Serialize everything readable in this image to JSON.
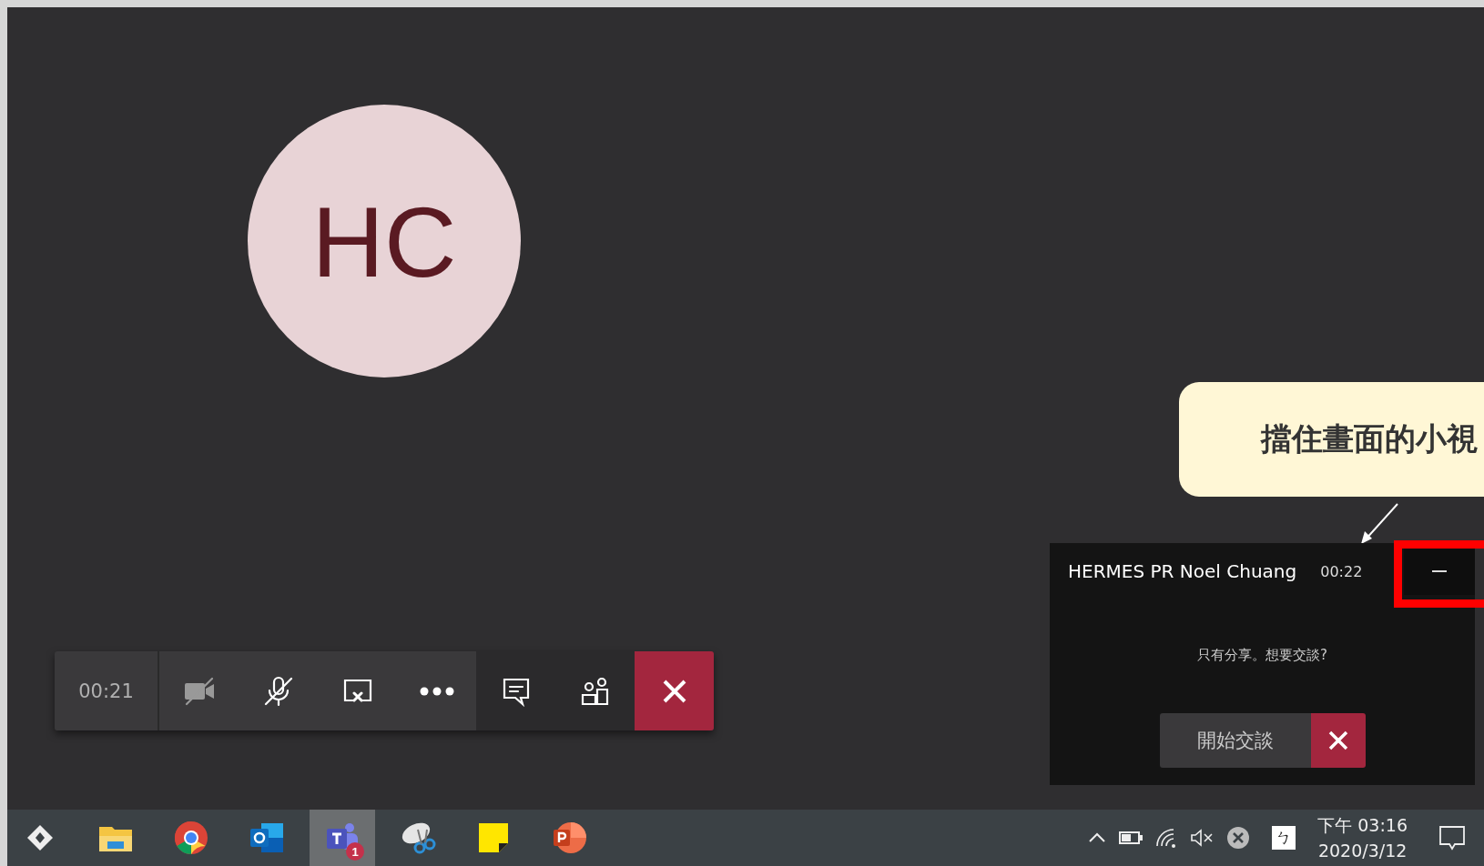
{
  "avatar": {
    "initials": "HC"
  },
  "toolbar": {
    "timer": "00:21",
    "buttons": [
      {
        "kind": "camera",
        "off": true
      },
      {
        "kind": "mic",
        "off": true
      },
      {
        "kind": "share"
      },
      {
        "kind": "more"
      },
      {
        "kind": "chat"
      },
      {
        "kind": "people"
      },
      {
        "kind": "hangup"
      }
    ]
  },
  "annotation": {
    "text": "擋住畫面的小視",
    "highlight": true
  },
  "mini_window": {
    "title": "HERMES PR Noel Chuang",
    "time": "00:22",
    "message": "只有分享。想要交談?",
    "start_button": "開始交談"
  },
  "taskbar": {
    "apps": [
      {
        "kind": "media",
        "active": false
      },
      {
        "kind": "folder",
        "active": false
      },
      {
        "kind": "chrome",
        "active": false
      },
      {
        "kind": "outlook",
        "active": false
      },
      {
        "kind": "teams",
        "active": true,
        "badge": "1"
      },
      {
        "kind": "snip",
        "active": false
      },
      {
        "kind": "notes",
        "active": false
      },
      {
        "kind": "powerpoint",
        "active": false
      }
    ],
    "ime": "ㄅ",
    "time": "下午 03:16",
    "date": "2020/3/12"
  }
}
